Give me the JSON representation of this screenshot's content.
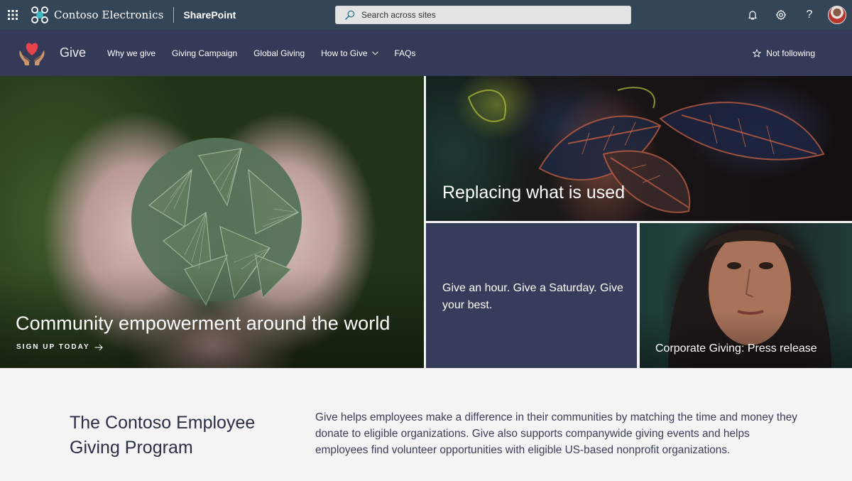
{
  "suitebar": {
    "org_name": "Contoso Electronics",
    "app_name": "SharePoint",
    "search_placeholder": "Search across sites",
    "icons": [
      "app-launcher-icon",
      "bell-icon",
      "gear-icon",
      "help-icon",
      "avatar"
    ]
  },
  "site": {
    "title": "Give",
    "nav": [
      {
        "label": "Why we give"
      },
      {
        "label": "Giving Campaign"
      },
      {
        "label": "Global Giving"
      },
      {
        "label": "How to Give",
        "has_dropdown": true
      },
      {
        "label": "FAQs"
      }
    ],
    "follow_label": "Not following"
  },
  "hero": {
    "main": {
      "title": "Community empowerment around the world",
      "cta": "SIGN UP TODAY",
      "image": "hands holding pine needles"
    },
    "top_right": {
      "title": "Replacing what is used",
      "image": "croton leaves"
    },
    "quote": {
      "title": "Give an hour. Give a Saturday. Give your best."
    },
    "portrait": {
      "title": "Corporate Giving: Press release",
      "image": "woman in headscarf"
    }
  },
  "about": {
    "title": "The Contoso Employee Giving Program",
    "body": "Give helps employees make a difference in their communities by matching the time and money they donate to eligible organizations. Give also supports companywide giving events and helps employees find volunteer opportunities with eligible US-based nonprofit organizations."
  },
  "colors": {
    "suitebar_bg": "#344558",
    "header_bg": "#353b56",
    "quote_tile_bg": "#363c59",
    "page_bg": "#f4f4f4",
    "logo_accent": "#3bb7bf"
  }
}
